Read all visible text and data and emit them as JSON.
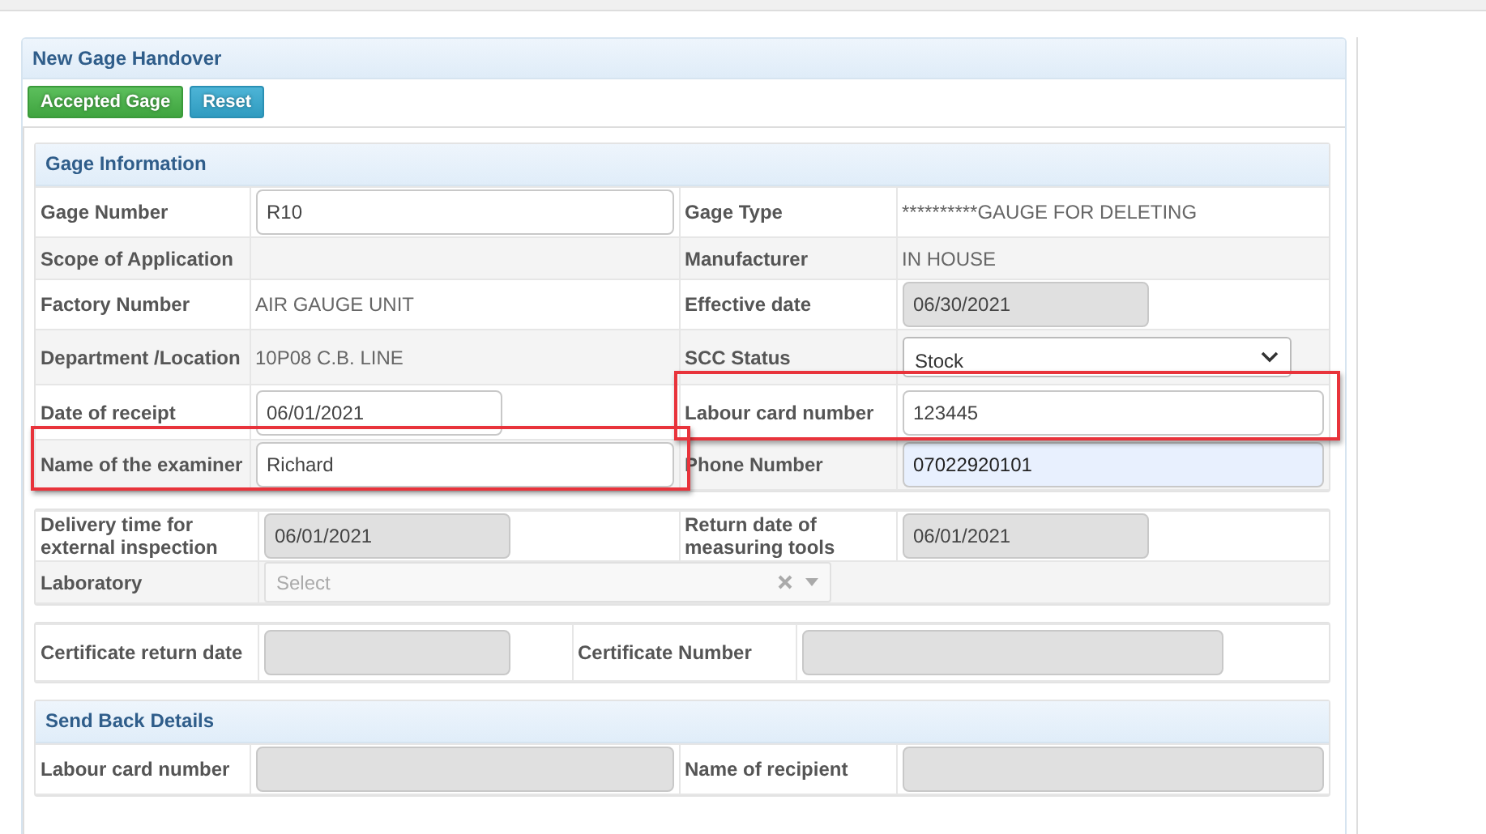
{
  "panel": {
    "title": "New Gage Handover"
  },
  "buttons": [
    {
      "label": "Accepted Gage",
      "kind": "success"
    },
    {
      "label": "Reset",
      "kind": "info"
    }
  ],
  "sections": [
    {
      "title": "Gage Information",
      "rows": [
        {
          "pairs": [
            {
              "label": "Gage Number",
              "field": {
                "kind": "input",
                "value": "R10",
                "disabled": false,
                "autofilled": false
              },
              "highlighted": false
            },
            {
              "label": "Gage Type",
              "field": {
                "kind": "text",
                "text": "**********GAUGE FOR DELETING"
              },
              "highlighted": false
            }
          ]
        },
        {
          "pairs": [
            {
              "label": "Scope of Application",
              "field": {
                "kind": "blank"
              },
              "highlighted": false
            },
            {
              "label": "Manufacturer",
              "field": {
                "kind": "text",
                "text": "IN HOUSE"
              },
              "highlighted": false
            }
          ]
        },
        {
          "pairs": [
            {
              "label": "Factory Number",
              "field": {
                "kind": "text",
                "text": "AIR GAUGE UNIT"
              },
              "highlighted": false
            },
            {
              "label": "Effective date",
              "field": {
                "kind": "input",
                "value": "06/30/2021",
                "disabled": true,
                "autofilled": false
              },
              "highlighted": false
            }
          ]
        },
        {
          "pairs": [
            {
              "label": "Department /Location",
              "field": {
                "kind": "text",
                "text": "10P08 C.B. LINE"
              },
              "highlighted": false
            },
            {
              "label": "SCC Status",
              "field": {
                "kind": "select",
                "value": "Stock"
              },
              "highlighted": false
            }
          ]
        },
        {
          "pairs": [
            {
              "label": "Date of receipt",
              "field": {
                "kind": "input",
                "value": "06/01/2021",
                "disabled": false,
                "autofilled": false
              },
              "highlighted": false
            },
            {
              "label": "Labour card number",
              "field": {
                "kind": "input",
                "value": "123445",
                "disabled": false,
                "autofilled": false
              },
              "highlighted": true
            }
          ]
        },
        {
          "pairs": [
            {
              "label": "Name of the examiner",
              "field": {
                "kind": "input",
                "value": "Richard",
                "disabled": false,
                "autofilled": false
              },
              "highlighted": true
            },
            {
              "label": "Phone Number",
              "field": {
                "kind": "input",
                "value": "07022920101",
                "disabled": false,
                "autofilled": true
              },
              "highlighted": false
            }
          ]
        }
      ]
    },
    {
      "rows": [
        {
          "pairs": [
            {
              "label": "Delivery time for external inspection",
              "field": {
                "kind": "input",
                "value": "06/01/2021",
                "disabled": true,
                "autofilled": false
              },
              "highlighted": false
            },
            {
              "label": "Return date of measuring tools",
              "field": {
                "kind": "input",
                "value": "06/01/2021",
                "disabled": true,
                "autofilled": false
              },
              "highlighted": false
            }
          ]
        },
        {
          "pairs": [
            {
              "label": "Laboratory",
              "field": {
                "kind": "combo",
                "placeholder": "Select"
              },
              "highlighted": false
            }
          ]
        }
      ]
    },
    {
      "rows": [
        {
          "pairs": [
            {
              "label": "Certificate return date",
              "field": {
                "kind": "input",
                "disabled": true,
                "autofilled": false
              },
              "highlighted": false
            },
            {
              "label": "Certificate Number",
              "field": {
                "kind": "input",
                "disabled": true,
                "autofilled": false
              },
              "highlighted": false
            }
          ]
        }
      ]
    },
    {
      "title": "Send Back Details",
      "rows": [
        {
          "pairs": [
            {
              "label": "Labour card number",
              "field": {
                "kind": "input",
                "disabled": true,
                "autofilled": false
              },
              "highlighted": false
            },
            {
              "label": "Name of recipient",
              "field": {
                "kind": "input",
                "disabled": true,
                "autofilled": false
              },
              "highlighted": false
            }
          ]
        }
      ]
    }
  ]
}
